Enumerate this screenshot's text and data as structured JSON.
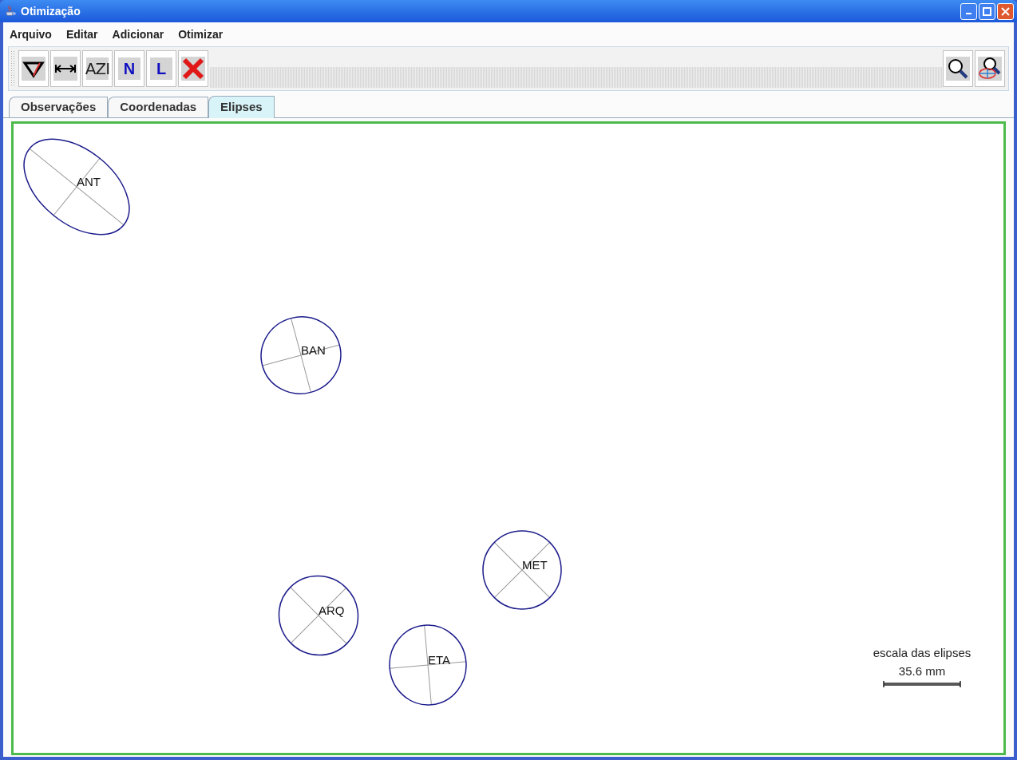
{
  "window": {
    "title": "Otimização"
  },
  "menu": [
    "Arquivo",
    "Editar",
    "Adicionar",
    "Otimizar"
  ],
  "toolbar": [
    {
      "kind": "angle"
    },
    {
      "kind": "distance"
    },
    {
      "kind": "label",
      "label": "AZI"
    },
    {
      "kind": "letter",
      "label": "N"
    },
    {
      "kind": "letter",
      "label": "L"
    },
    {
      "kind": "delete"
    }
  ],
  "toolbar_right": [
    {
      "kind": "zoom"
    },
    {
      "kind": "zoom-ellipse"
    }
  ],
  "tabs": [
    {
      "label": "Observações",
      "selected": false
    },
    {
      "label": "Coordenadas",
      "selected": false
    },
    {
      "label": "Elipses",
      "selected": true
    }
  ],
  "stations": [
    {
      "label": "ANT"
    },
    {
      "label": "BAN"
    },
    {
      "label": "ARQ"
    },
    {
      "label": "ETA"
    },
    {
      "label": "MET"
    }
  ],
  "scale": {
    "title": "escala das elipses",
    "value": "35.6 mm"
  }
}
